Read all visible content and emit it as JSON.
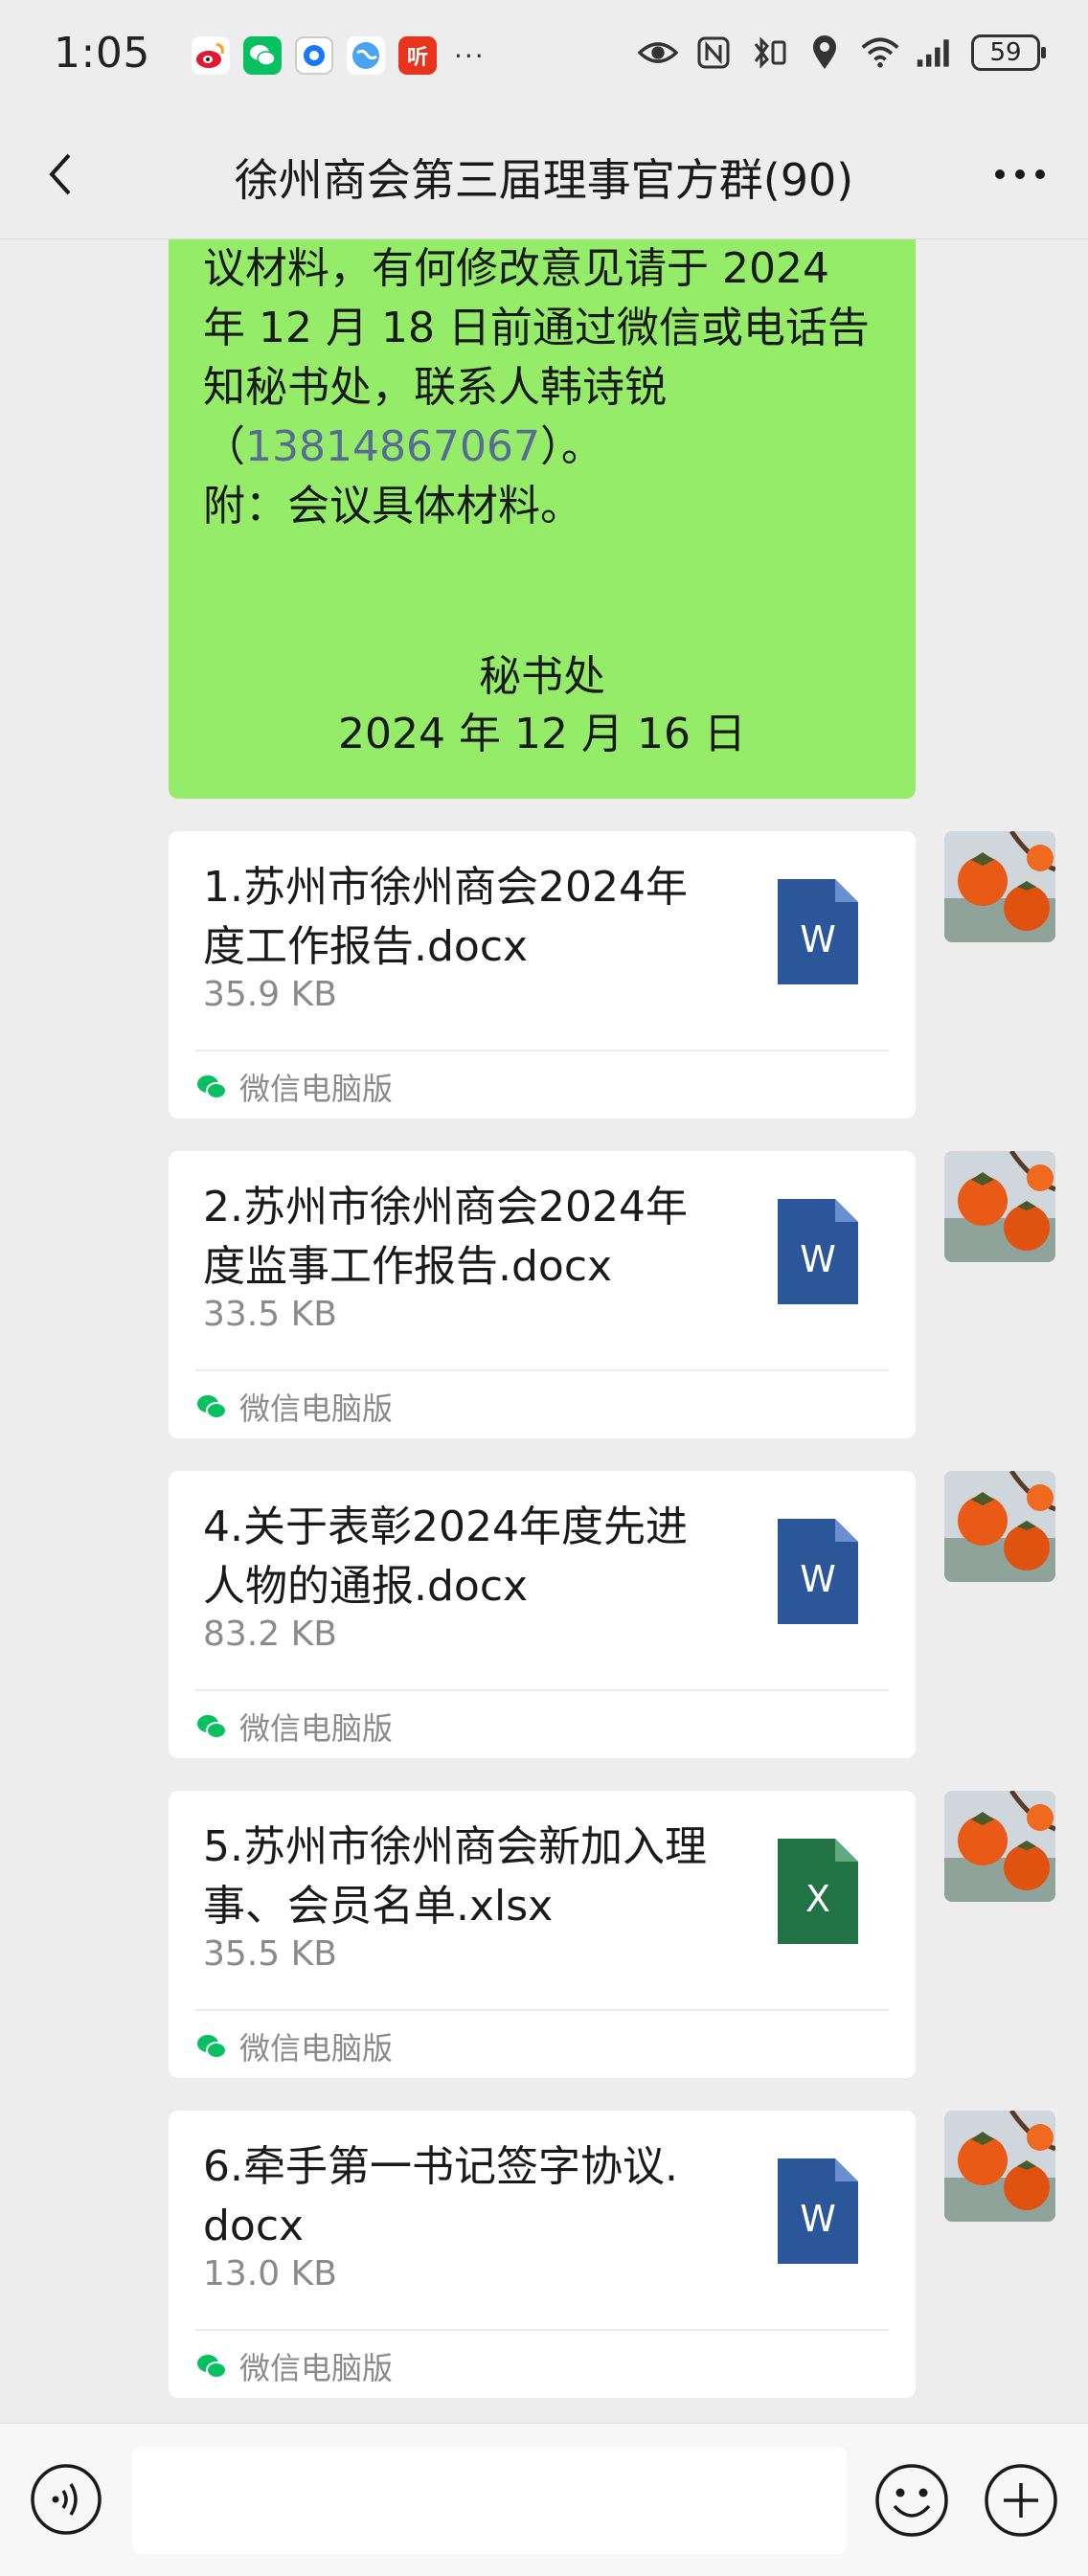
{
  "status_bar": {
    "time": "1:05",
    "app_icons": [
      "weibo-icon",
      "wechat-icon",
      "browser-icon",
      "globe-icon",
      "listen-icon"
    ],
    "listen_app_label": "听",
    "more_dots": "···",
    "battery": "59"
  },
  "header": {
    "title": "徐州商会第三届理事官方群(90)"
  },
  "announcement": {
    "lines": [
      "议材料，有何修改意见请于 2024",
      "年 12 月 18 日前通过微信或电话告",
      "知秘书处，联系人韩诗锐"
    ],
    "phone_open": "（",
    "phone": "13814867067",
    "phone_close": "）。",
    "attach": "附：会议具体材料。",
    "signer": "秘书处",
    "date": "2024 年 12 月 16 日"
  },
  "files": [
    {
      "name": "1.苏州市徐州商会2024年度工作报告.docx",
      "name_l1": "1.苏州市徐州商会2024年",
      "name_l2": "度工作报告.docx",
      "size": "35.9 KB",
      "type": "W",
      "type_color": "#2b579a",
      "source": "微信电脑版"
    },
    {
      "name": "2.苏州市徐州商会2024年度监事工作报告.docx",
      "name_l1": "2.苏州市徐州商会2024年",
      "name_l2": "度监事工作报告.docx",
      "size": "33.5 KB",
      "type": "W",
      "type_color": "#2b579a",
      "source": "微信电脑版"
    },
    {
      "name": "4.关于表彰2024年度先进人物的通报.docx",
      "name_l1": "4.关于表彰2024年度先进",
      "name_l2": "人物的通报.docx",
      "size": "83.2 KB",
      "type": "W",
      "type_color": "#2b579a",
      "source": "微信电脑版"
    },
    {
      "name": "5.苏州市徐州商会新加入理事、会员名单.xlsx",
      "name_l1": "5.苏州市徐州商会新加入理",
      "name_l2": "事、会员名单.xlsx",
      "size": "35.5 KB",
      "type": "X",
      "type_color": "#217346",
      "source": "微信电脑版"
    },
    {
      "name": "6.牵手第一书记签字协议.docx",
      "name_l1": "6.牵手第一书记签字协议.",
      "name_l2": "docx",
      "size": "13.0 KB",
      "type": "W",
      "type_color": "#2b579a",
      "source": "微信电脑版"
    }
  ],
  "colors": {
    "bubble_green": "#95ec69",
    "link_blue": "#576b95",
    "chat_bg": "#ededed"
  },
  "input_bar": {
    "icons": [
      "voice-icon",
      "emoji-icon",
      "plus-icon"
    ]
  }
}
